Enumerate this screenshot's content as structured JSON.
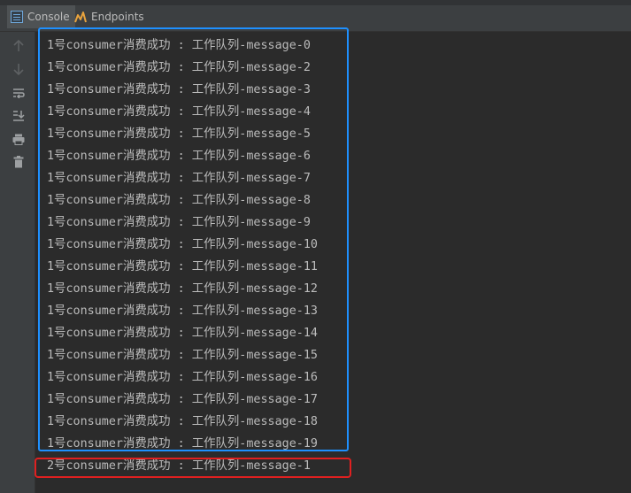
{
  "tabs": [
    {
      "label": "Console",
      "icon": "console-icon",
      "active": true
    },
    {
      "label": "Endpoints",
      "icon": "endpoints-icon",
      "active": false
    }
  ],
  "toolbar": [
    {
      "icon": "scroll-up-icon"
    },
    {
      "icon": "scroll-down-icon"
    },
    {
      "icon": "soft-wrap-icon"
    },
    {
      "icon": "scroll-to-end-icon"
    },
    {
      "icon": "print-icon"
    },
    {
      "icon": "clear-all-icon"
    }
  ],
  "console": {
    "lines": [
      "1号consumer消费成功 : 工作队列-message-0",
      "1号consumer消费成功 : 工作队列-message-2",
      "1号consumer消费成功 : 工作队列-message-3",
      "1号consumer消费成功 : 工作队列-message-4",
      "1号consumer消费成功 : 工作队列-message-5",
      "1号consumer消费成功 : 工作队列-message-6",
      "1号consumer消费成功 : 工作队列-message-7",
      "1号consumer消费成功 : 工作队列-message-8",
      "1号consumer消费成功 : 工作队列-message-9",
      "1号consumer消费成功 : 工作队列-message-10",
      "1号consumer消费成功 : 工作队列-message-11",
      "1号consumer消费成功 : 工作队列-message-12",
      "1号consumer消费成功 : 工作队列-message-13",
      "1号consumer消费成功 : 工作队列-message-14",
      "1号consumer消费成功 : 工作队列-message-15",
      "1号consumer消费成功 : 工作队列-message-16",
      "1号consumer消费成功 : 工作队列-message-17",
      "1号consumer消费成功 : 工作队列-message-18",
      "1号consumer消费成功 : 工作队列-message-19",
      "2号consumer消费成功 : 工作队列-message-1"
    ]
  },
  "colors": {
    "background": "#2b2b2b",
    "text": "#bbbbbb",
    "highlight_consumer_1": "#1e90ff",
    "highlight_consumer_2": "#e02020"
  }
}
